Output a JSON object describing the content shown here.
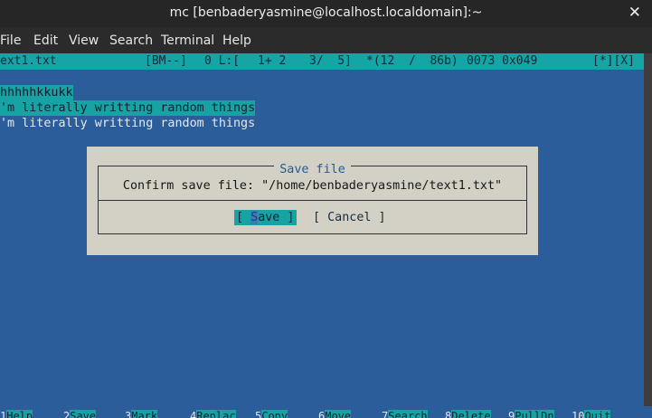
{
  "window": {
    "title": "mc [benbaderyasmine@localhost.localdomain]:~",
    "close_symbol": "✕"
  },
  "menu": [
    "File",
    "Edit",
    "View",
    "Search",
    "Terminal",
    "Help"
  ],
  "status": {
    "filename": "ext1.txt",
    "mode": "[BM--]",
    "col": "0 L:[",
    "line_info": "1+ 2",
    "line_count": "3/  5]",
    "size": "*(12  /  86b)",
    "char": "0073 0x049",
    "flags": "[*][X]"
  },
  "editor": {
    "lines": [
      "hhhhhkkukk",
      "'m literally writting random things",
      "'m literally writting random things"
    ]
  },
  "dialog": {
    "title": "Save file",
    "message": "Confirm save file: \"/home/benbaderyasmine/text1.txt\"",
    "save_open": "[ ",
    "save_hot": "S",
    "save_rest": "ave ]",
    "cancel": "[ Cancel ]"
  },
  "function_keys": [
    {
      "num": "1",
      "label": "Help"
    },
    {
      "num": "2",
      "label": "Save"
    },
    {
      "num": "3",
      "label": "Mark"
    },
    {
      "num": "4",
      "label": "Replac"
    },
    {
      "num": "5",
      "label": "Copy"
    },
    {
      "num": "6",
      "label": "Move"
    },
    {
      "num": "7",
      "label": "Search"
    },
    {
      "num": "8",
      "label": "Delete"
    },
    {
      "num": "9",
      "label": "PullDn"
    },
    {
      "num": "10",
      "label": "Quit"
    }
  ]
}
